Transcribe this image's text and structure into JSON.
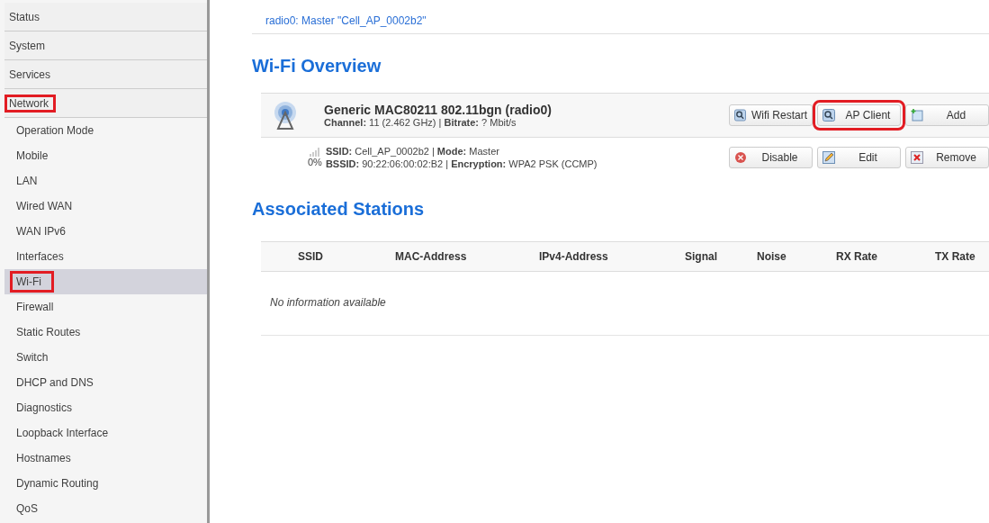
{
  "sidebar": {
    "items": [
      {
        "label": "Status",
        "highlighted": false
      },
      {
        "label": "System",
        "highlighted": false
      },
      {
        "label": "Services",
        "highlighted": false
      },
      {
        "label": "Network",
        "highlighted": true,
        "children": [
          {
            "label": "Operation Mode",
            "selected": false,
            "highlighted": false
          },
          {
            "label": "Mobile",
            "selected": false,
            "highlighted": false
          },
          {
            "label": "LAN",
            "selected": false,
            "highlighted": false
          },
          {
            "label": "Wired WAN",
            "selected": false,
            "highlighted": false
          },
          {
            "label": "WAN IPv6",
            "selected": false,
            "highlighted": false
          },
          {
            "label": "Interfaces",
            "selected": false,
            "highlighted": false
          },
          {
            "label": "Wi-Fi",
            "selected": true,
            "highlighted": true
          },
          {
            "label": "Firewall",
            "selected": false,
            "highlighted": false
          },
          {
            "label": "Static Routes",
            "selected": false,
            "highlighted": false
          },
          {
            "label": "Switch",
            "selected": false,
            "highlighted": false
          },
          {
            "label": "DHCP and DNS",
            "selected": false,
            "highlighted": false
          },
          {
            "label": "Diagnostics",
            "selected": false,
            "highlighted": false
          },
          {
            "label": "Loopback Interface",
            "selected": false,
            "highlighted": false
          },
          {
            "label": "Hostnames",
            "selected": false,
            "highlighted": false
          },
          {
            "label": "Dynamic Routing",
            "selected": false,
            "highlighted": false
          },
          {
            "label": "QoS",
            "selected": false,
            "highlighted": false
          }
        ]
      }
    ]
  },
  "breadcrumb": "radio0: Master \"Cell_AP_0002b2\"",
  "overview": {
    "title": "Wi-Fi Overview",
    "device": {
      "name": "Generic MAC80211 802.11bgn (radio0)",
      "details": "**Channel:** 11 (2.462 GHz) | **Bitrate:** ? Mbit/s",
      "buttons": [
        {
          "label": "Wifi Restart",
          "kind": "search",
          "highlighted": false
        },
        {
          "label": "AP Client",
          "kind": "search",
          "highlighted": true
        },
        {
          "label": "Add",
          "kind": "add",
          "highlighted": false
        }
      ]
    },
    "network": {
      "signal": "0%",
      "line_1": "**SSID:** Cell_AP_0002b2 | **Mode:** Master",
      "line_2": "**BSSID:** 90:22:06:00:02:B2 | **Encryption:** WPA2 PSK (CCMP)",
      "buttons": [
        {
          "label": "Disable",
          "kind": "disable",
          "highlighted": false
        },
        {
          "label": "Edit",
          "kind": "edit",
          "highlighted": false
        },
        {
          "label": "Remove",
          "kind": "remove",
          "highlighted": false
        }
      ]
    }
  },
  "stations": {
    "title": "Associated Stations",
    "columns": [
      "SSID",
      "MAC-Address",
      "IPv4-Address",
      "Signal",
      "Noise",
      "RX Rate",
      "TX Rate"
    ],
    "empty": "No information available"
  }
}
